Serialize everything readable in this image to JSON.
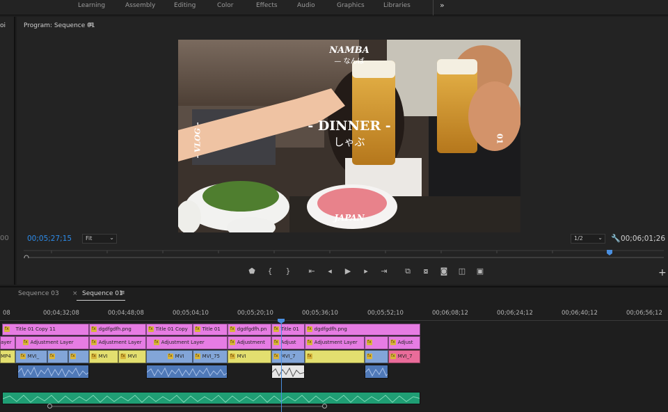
{
  "workspaces": [
    "Learning",
    "Assembly",
    "Editing",
    "Color",
    "Effects",
    "Audio",
    "Graphics",
    "Libraries"
  ],
  "more_icon": "double-chevron-right-icon",
  "left_panel": {
    "label": "oi",
    "timecode": "00"
  },
  "program": {
    "title": "Program: Sequence 01",
    "menu_icon": "hamburger-menu-icon",
    "current_timecode": "00;05;27;15",
    "fit_value": "Fit",
    "resolution_value": "1/2",
    "duration_timecode": "00;06;01;26",
    "overlays": {
      "top_title": "NAMBA",
      "top_sub": "— なんば",
      "left_vertical": "- VLOG -",
      "center_title": "- DINNER -",
      "center_sub": "しゃぶ",
      "right_vertical": "01",
      "bottom": "JAPAN"
    }
  },
  "transport_icons": [
    "marker-icon",
    "mark-in-icon",
    "mark-out-icon",
    "go-to-in-icon",
    "step-back-icon",
    "play-icon",
    "step-forward-icon",
    "go-to-out-icon",
    "insert-icon",
    "overwrite-icon",
    "export-frame-icon",
    "comparison-view-icon",
    "multi-camera-icon"
  ],
  "timeline": {
    "tabs": [
      "Sequence 03",
      "Sequence 01"
    ],
    "close_icon": "×",
    "active_tab": "Sequence 01",
    "ruler_labels": [
      "08",
      "00;04;32;08",
      "00;04;48;08",
      "00;05;04;10",
      "00;05;20;10",
      "00;05;36;10",
      "00;05;52;10",
      "00;06;08;12",
      "00;06;24;12",
      "00;06;40;12",
      "00;06;56;12"
    ],
    "track_v3": [
      "Title 01 Copy 11",
      "dgdfgdfh.png",
      "Title 01 Copy",
      "Title 01",
      "dgdfgdfh.pn",
      "Title 01",
      "dgdfgdfh.png"
    ],
    "track_v2": [
      "ayer",
      "Adjustment Layer",
      "Adjustment Layer",
      "Adjustment Layer",
      "Adjustment",
      "Adjust",
      "Adjustment Layer",
      "Adjust"
    ],
    "track_v1": [
      "MP4",
      "MVI_",
      "MVI",
      "MVI",
      "MVI_75",
      "MVI",
      "MVI_7",
      "MVI_7"
    ],
    "fx_label": "fx"
  },
  "colors": {
    "accent_blue": "#2d8ceb",
    "title_clip": "#e67ce3",
    "video_yellow": "#e3df6f",
    "video_blue": "#82a5d8",
    "video_red": "#ea6c9a",
    "audio_blue": "#4f79b8",
    "audio_green": "#1f9e74"
  }
}
